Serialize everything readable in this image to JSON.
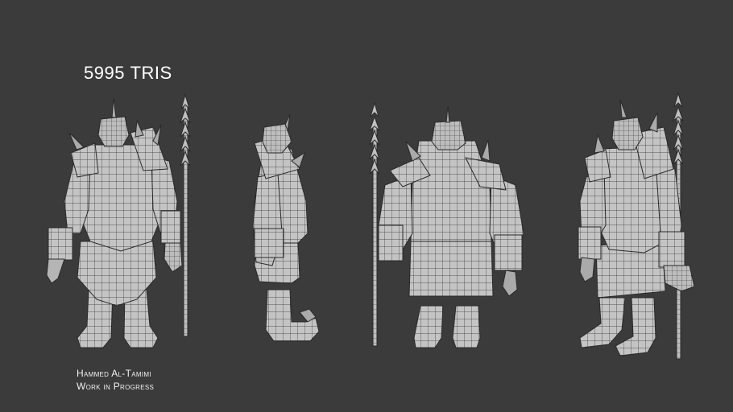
{
  "stats": {
    "tri_number": "5995",
    "tri_unit": "TRIS"
  },
  "credits": {
    "author": "Hammed Al-Tamimi",
    "status": "Work in Progress"
  },
  "views": [
    {
      "name": "front"
    },
    {
      "name": "side"
    },
    {
      "name": "back"
    },
    {
      "name": "three-quarter"
    }
  ],
  "colors": {
    "background": "#3b3b3b",
    "mesh_fill": "#c9c9c9",
    "mesh_shadow": "#9a9a9a",
    "wire": "#2a2a2a",
    "text": "#ffffff"
  }
}
